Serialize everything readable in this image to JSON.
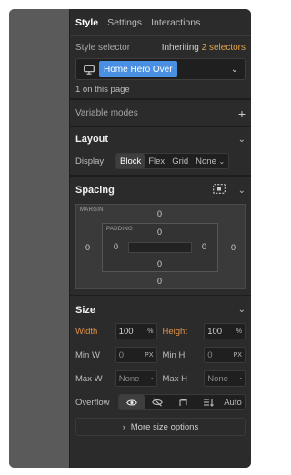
{
  "tabs": [
    {
      "label": "Style",
      "active": true
    },
    {
      "label": "Settings",
      "active": false
    },
    {
      "label": "Interactions",
      "active": false
    }
  ],
  "style_selector": {
    "label": "Style selector",
    "inheriting_text": "Inheriting",
    "inheriting_link": "2 selectors",
    "current_selector": "Home Hero Over",
    "on_page": "1 on this page"
  },
  "variable_modes": {
    "label": "Variable modes"
  },
  "layout": {
    "title": "Layout",
    "display_label": "Display",
    "display_options": [
      "Block",
      "Flex",
      "Grid",
      "None"
    ],
    "display_selected": "Block"
  },
  "spacing": {
    "title": "Spacing",
    "margin_label": "MARGIN",
    "padding_label": "PADDING",
    "margin": {
      "top": "0",
      "right": "0",
      "bottom": "0",
      "left": "0"
    },
    "padding": {
      "top": "0",
      "right": "0",
      "bottom": "0",
      "left": "0"
    }
  },
  "size": {
    "title": "Size",
    "width_label": "Width",
    "width_value": "100",
    "width_unit": "%",
    "height_label": "Height",
    "height_value": "100",
    "height_unit": "%",
    "min_w_label": "Min W",
    "min_w_value": "0",
    "min_w_unit": "PX",
    "min_h_label": "Min H",
    "min_h_value": "0",
    "min_h_unit": "PX",
    "max_w_label": "Max W",
    "max_w_value": "None",
    "max_w_unit": "-",
    "max_h_label": "Max H",
    "max_h_value": "None",
    "max_h_unit": "-",
    "overflow_label": "Overflow",
    "overflow_auto": "Auto",
    "more_label": "More size options"
  },
  "colors": {
    "accent_orange": "#e0914a",
    "selector_chip": "#4a90e2",
    "panel_bg": "#2b2b2b"
  }
}
